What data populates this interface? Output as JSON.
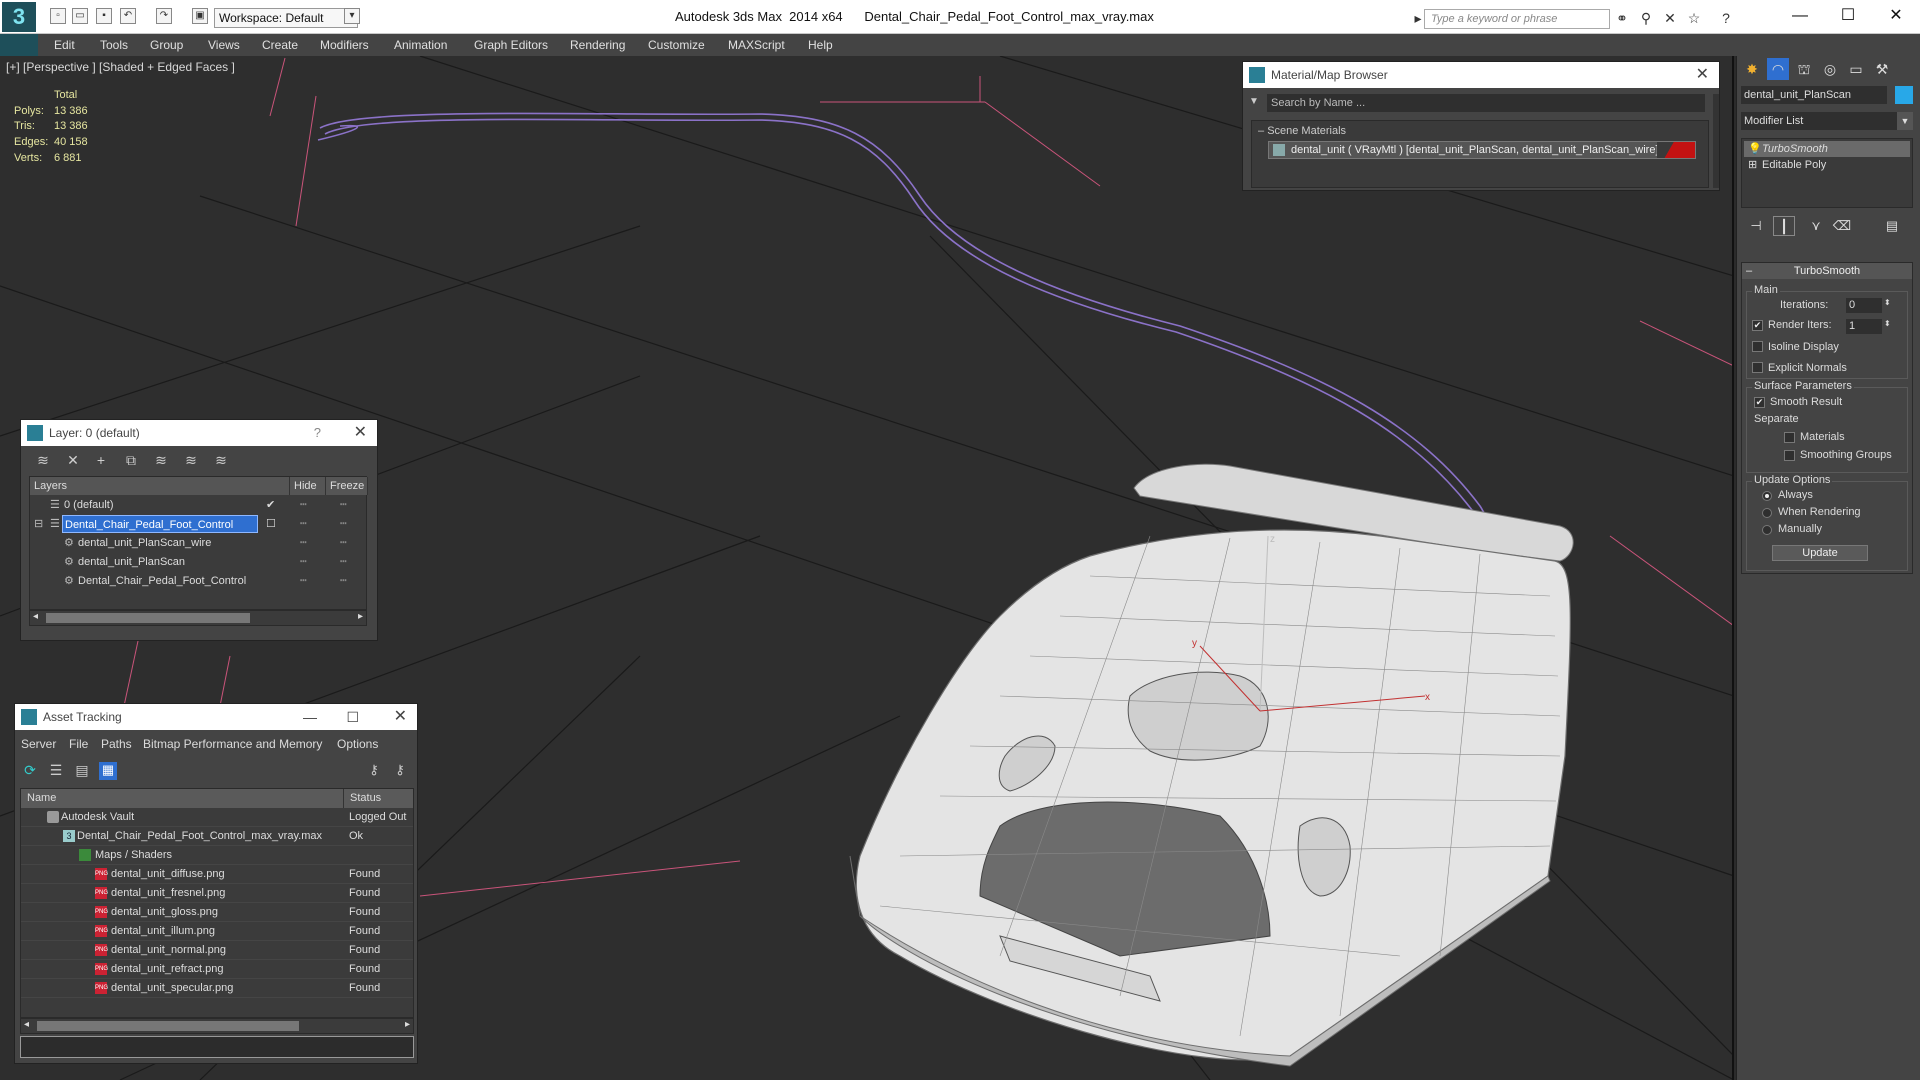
{
  "app": {
    "title_product": "Autodesk 3ds Max  2014 x64",
    "title_file": "Dental_Chair_Pedal_Foot_Control_max_vray.max",
    "workspace": "Workspace: Default",
    "search_placeholder": "Type a keyword or phrase",
    "logo": "3"
  },
  "menu": [
    "Edit",
    "Tools",
    "Group",
    "Views",
    "Create",
    "Modifiers",
    "Animation",
    "Graph Editors",
    "Rendering",
    "Customize",
    "MAXScript",
    "Help"
  ],
  "viewport": {
    "label": "[+] [Perspective ] [Shaded + Edged Faces ]",
    "stats": {
      "header": "Total",
      "rows": [
        {
          "label": "Polys:",
          "value": "13 386"
        },
        {
          "label": "Tris:",
          "value": "13 386"
        },
        {
          "label": "Edges:",
          "value": "40 158"
        },
        {
          "label": "Verts:",
          "value": "6 881"
        }
      ]
    },
    "gizmo_axes": [
      "x",
      "y",
      "z"
    ]
  },
  "material_browser": {
    "title": "Material/Map Browser",
    "search_placeholder": "Search by Name ...",
    "section": "Scene Materials",
    "material_row": "dental_unit  ( VRayMtl )  [dental_unit_PlanScan, dental_unit_PlanScan_wire]"
  },
  "layer_panel": {
    "title": "Layer: 0 (default)",
    "help": "?",
    "columns": {
      "layers": "Layers",
      "hide": "Hide",
      "freeze": "Freeze"
    },
    "rows": [
      {
        "name": "0 (default)",
        "indent": 1,
        "selected": false,
        "check": "✔"
      },
      {
        "name": "Dental_Chair_Pedal_Foot_Control",
        "indent": 1,
        "selected": true,
        "check": "☐"
      },
      {
        "name": "dental_unit_PlanScan_wire",
        "indent": 2,
        "selected": false,
        "check": ""
      },
      {
        "name": "dental_unit_PlanScan",
        "indent": 2,
        "selected": false,
        "check": ""
      },
      {
        "name": "Dental_Chair_Pedal_Foot_Control",
        "indent": 2,
        "selected": false,
        "check": ""
      }
    ]
  },
  "asset_tracking": {
    "title": "Asset Tracking",
    "menu": [
      "Server",
      "File",
      "Paths",
      "Bitmap Performance and Memory",
      "Options"
    ],
    "columns": {
      "name": "Name",
      "status": "Status"
    },
    "rows": [
      {
        "name": "Autodesk Vault",
        "status": "Logged Out",
        "indent": 1,
        "icon": "vault-icon"
      },
      {
        "name": "Dental_Chair_Pedal_Foot_Control_max_vray.max",
        "status": "Ok",
        "indent": 2,
        "icon": "max-file-icon"
      },
      {
        "name": "Maps / Shaders",
        "status": "",
        "indent": 3,
        "icon": "folder-icon"
      },
      {
        "name": "dental_unit_diffuse.png",
        "status": "Found",
        "indent": 4,
        "icon": "png-icon"
      },
      {
        "name": "dental_unit_fresnel.png",
        "status": "Found",
        "indent": 4,
        "icon": "png-icon"
      },
      {
        "name": "dental_unit_gloss.png",
        "status": "Found",
        "indent": 4,
        "icon": "png-icon"
      },
      {
        "name": "dental_unit_illum.png",
        "status": "Found",
        "indent": 4,
        "icon": "png-icon"
      },
      {
        "name": "dental_unit_normal.png",
        "status": "Found",
        "indent": 4,
        "icon": "png-icon"
      },
      {
        "name": "dental_unit_refract.png",
        "status": "Found",
        "indent": 4,
        "icon": "png-icon"
      },
      {
        "name": "dental_unit_specular.png",
        "status": "Found",
        "indent": 4,
        "icon": "png-icon"
      }
    ]
  },
  "command_panel": {
    "object_name": "dental_unit_PlanScan",
    "object_color": "#28a8e8",
    "modifier_list": "Modifier List",
    "stack": [
      "TurboSmooth",
      "Editable Poly"
    ],
    "rollout_title": "TurboSmooth",
    "main_label": "Main",
    "iterations_label": "Iterations:",
    "iterations_value": "0",
    "render_iters_label": "Render Iters:",
    "render_iters_value": "1",
    "render_iters_checked": true,
    "isoline_label": "Isoline Display",
    "isoline_checked": false,
    "explicit_normals_label": "Explicit Normals",
    "explicit_normals_checked": false,
    "surface_params_label": "Surface Parameters",
    "smooth_result_label": "Smooth Result",
    "smooth_result_checked": true,
    "separate_label": "Separate",
    "materials_label": "Materials",
    "materials_checked": false,
    "smoothing_groups_label": "Smoothing Groups",
    "smoothing_groups_checked": false,
    "update_options_label": "Update Options",
    "radio_always": "Always",
    "radio_when_rendering": "When Rendering",
    "radio_manually": "Manually",
    "radio_selected": "Always",
    "update_button": "Update"
  },
  "colors": {
    "ui_dark": "#444444",
    "viewport_bg": "#2e2e2e",
    "selection": "#2f6fd0",
    "grid_red": "#c9547a",
    "wire_purple": "#8b72c8",
    "stats": "#e6e6a0"
  }
}
